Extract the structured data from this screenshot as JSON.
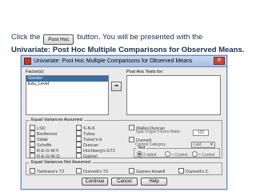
{
  "instruction": {
    "prefix": "Click the",
    "button_label": "Post Hoc",
    "suffix": "button. You will be presented with the",
    "bold_line": "Univariate: Post Hoc Multiple Comparisons for Observed Means."
  },
  "dialog": {
    "title": "Univariate: Post Hoc Multiple Comparisons for Observed Means",
    "factors_label": "Factor(s):",
    "factors": [
      {
        "label": "Gender",
        "selected": true
      },
      {
        "label": "Edu_Level",
        "selected": false
      }
    ],
    "tests_label": "Post Hoc Tests for:",
    "equal_group": {
      "title": "Equal Variances Assumed",
      "col1": [
        "LSD",
        "Bonferroni",
        "Sidak",
        "Scheffe",
        "R-E-G-W-F",
        "R-E-G-W-Q"
      ],
      "col2": [
        "S-N-K",
        "Tukey",
        "Tukey's-b",
        "Duncan",
        "Hochberg's GT2",
        "Gabriel"
      ],
      "waller": "Waller-Duncan",
      "ratio_label": "Type I/Type II Error Ratio:",
      "ratio_value": "100",
      "dunnett": "Dunnett",
      "control_label": "Control Category:",
      "control_value": "Last",
      "test_label": "Test",
      "test_options": [
        "2-sided",
        "< Control",
        "> Control"
      ]
    },
    "unequal_group": {
      "title": "Equal Variances Not Assumed",
      "items": [
        "Tamhane's T2",
        "Dunnett's T3",
        "Games-Howell",
        "Dunnett's C"
      ]
    },
    "buttons": {
      "continue": "Continue",
      "cancel": "Cancel",
      "help": "Help"
    }
  }
}
